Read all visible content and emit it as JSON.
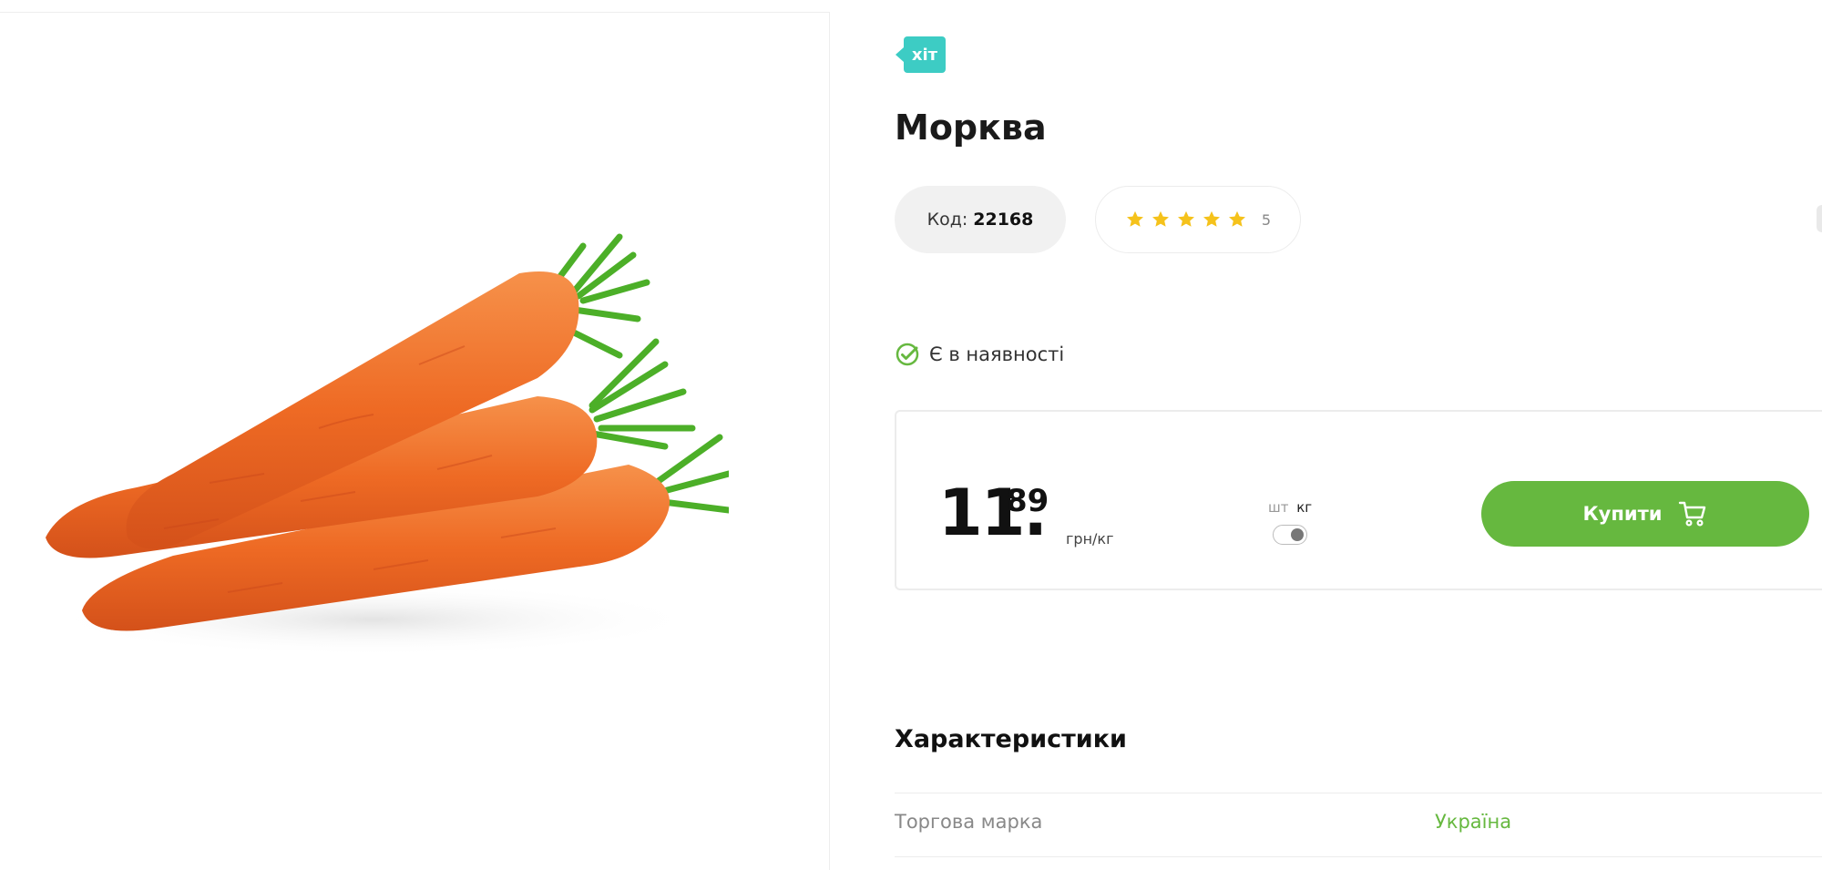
{
  "badge": "хіт",
  "product": {
    "title": "Морква",
    "code_label": "Код:",
    "code_value": "22168",
    "rating": 5,
    "rating_count": "5",
    "image_name": "carrots-image"
  },
  "stock": {
    "status": "Є в наявності"
  },
  "price": {
    "integer": "11.",
    "decimal": "89",
    "unit": "грн/кг",
    "unit_options": [
      "шт",
      "кг"
    ],
    "selected_unit": "кг"
  },
  "buy_button": {
    "label": "Купити",
    "icon": "cart-icon"
  },
  "specs": {
    "title": "Характеристики",
    "rows": [
      {
        "name": "Торгова марка",
        "value": "Україна"
      }
    ]
  },
  "colors": {
    "accent": "#66b83f",
    "badge": "#3dccc4",
    "star": "#f5c21b"
  }
}
